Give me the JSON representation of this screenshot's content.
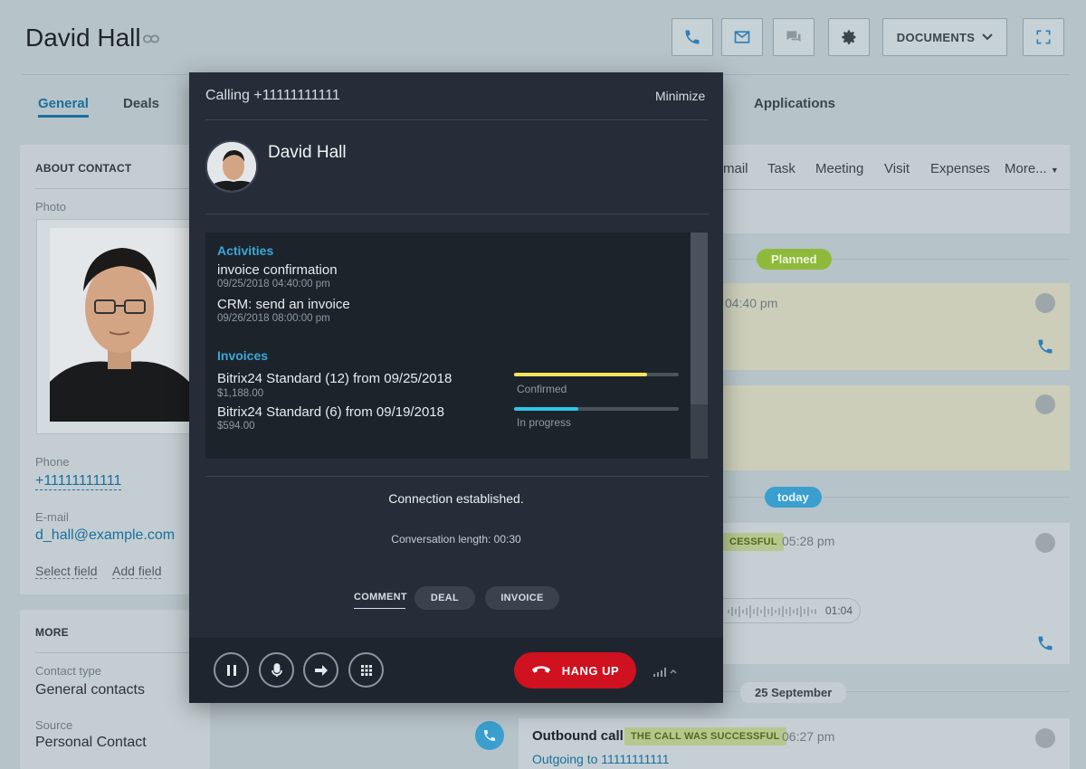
{
  "contact": {
    "name": "David Hall"
  },
  "toolbar": {
    "documents_label": "DOCUMENTS"
  },
  "tabs": [
    {
      "label": "General"
    },
    {
      "label": "Deals"
    },
    {
      "label": "Applications"
    }
  ],
  "about": {
    "title": "ABOUT CONTACT",
    "photo_label": "Photo",
    "phone_label": "Phone",
    "phone_value": "+11111111111",
    "email_label": "E-mail",
    "email_value": "d_hall@example.com",
    "select_field": "Select field",
    "add_field": "Add field"
  },
  "more": {
    "title": "MORE",
    "contact_type_label": "Contact type",
    "contact_type_value": "General contacts",
    "source_label": "Source",
    "source_value": "Personal Contact"
  },
  "activity_bar": {
    "items": [
      "mail",
      "Task",
      "Meeting",
      "Visit",
      "Expenses",
      "More..."
    ]
  },
  "timeline": {
    "planned_label": "Planned",
    "today_label": "today",
    "date_label": "25 September",
    "card1_time": "04:40 pm",
    "card3_status": "CESSFUL",
    "card3_time": "05:28 pm",
    "card3_duration": "01:04",
    "last_card": {
      "title": "Outbound call",
      "status": "THE CALL WAS SUCCESSFUL",
      "time": "06:27 pm",
      "link": "Outgoing to 11111111111"
    }
  },
  "call": {
    "header": "Calling +11111111111",
    "minimize": "Minimize",
    "contact_name": "David Hall",
    "activities_title": "Activities",
    "activities": [
      {
        "title": "invoice confirmation",
        "date": "09/25/2018 04:40:00 pm"
      },
      {
        "title": "CRM: send an invoice",
        "date": "09/26/2018 08:00:00 pm"
      }
    ],
    "invoices_title": "Invoices",
    "invoices": [
      {
        "title": "Bitrix24 Standard (12) from 09/25/2018",
        "amount": "$1,188.00",
        "status": "Confirmed",
        "progress": 0.81,
        "color": "#f2e55c"
      },
      {
        "title": "Bitrix24 Standard (6) from 09/19/2018",
        "amount": "$594.00",
        "status": "In progress",
        "progress": 0.39,
        "color": "#2bc7e8"
      }
    ],
    "status_text": "Connection established.",
    "conversation": "Conversation length: 00:30",
    "tabs": [
      "COMMENT",
      "DEAL",
      "INVOICE"
    ],
    "hangup_label": "HANG UP"
  },
  "colors": {
    "accent": "#1a6f9e",
    "modal_bg": "#262d38",
    "hangup": "#d0111f",
    "planned": "#8fb93a",
    "today": "#3a9fcf"
  }
}
